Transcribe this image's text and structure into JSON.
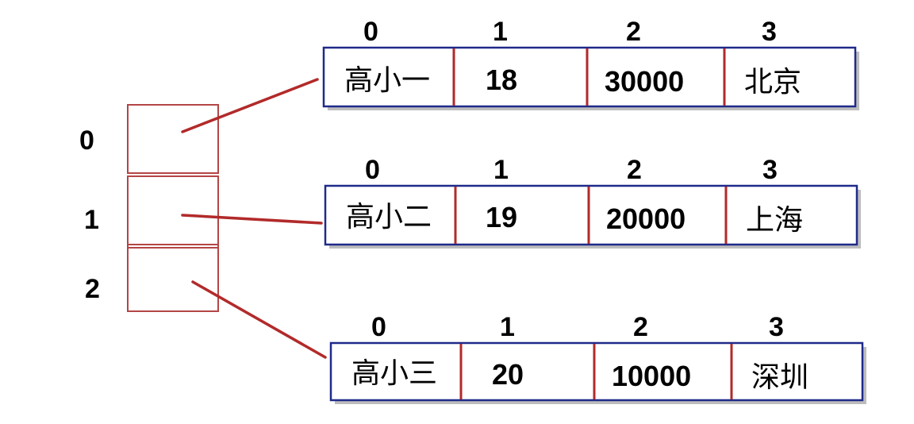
{
  "outer_array": {
    "indices": [
      "0",
      "1",
      "2"
    ]
  },
  "rows": [
    {
      "indices": [
        "0",
        "1",
        "2",
        "3"
      ],
      "cells": [
        "高小一",
        "18",
        "30000",
        "北京"
      ]
    },
    {
      "indices": [
        "0",
        "1",
        "2",
        "3"
      ],
      "cells": [
        "高小二",
        "19",
        "20000",
        "上海"
      ]
    },
    {
      "indices": [
        "0",
        "1",
        "2",
        "3"
      ],
      "cells": [
        "高小三",
        "20",
        "10000",
        "深圳"
      ]
    }
  ],
  "colors": {
    "row_border": "#1f2a8a",
    "separator": "#b22a2a",
    "outer_cell_border": "#b54545",
    "pointer": "#b22a2a"
  }
}
